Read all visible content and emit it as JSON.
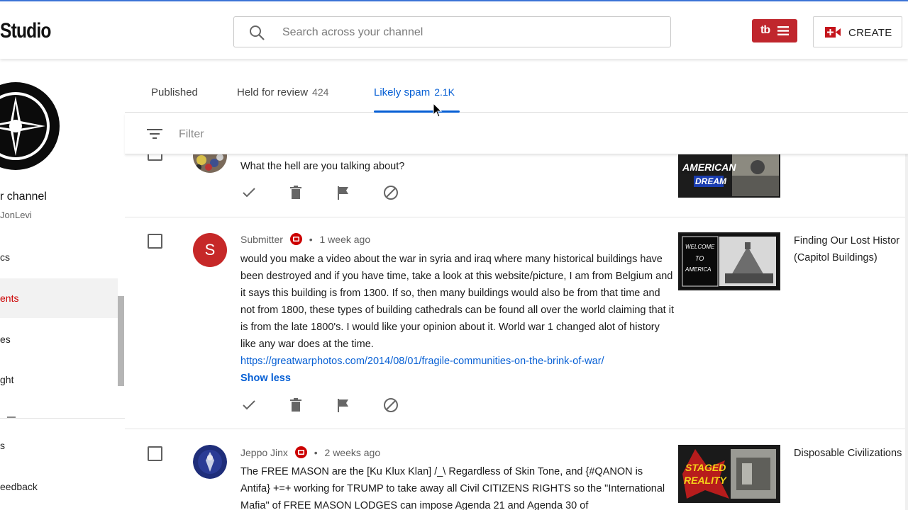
{
  "app": {
    "logo_text": "Studio"
  },
  "header": {
    "search_placeholder": "Search across your channel",
    "tubebuddy_label": "tb",
    "create_label": "CREATE"
  },
  "sidebar": {
    "channel_title": "r channel",
    "channel_handle": "JonLevi",
    "items": [
      {
        "label": "cs"
      },
      {
        "label": "ents",
        "active": true
      },
      {
        "label": "es"
      },
      {
        "label": "ght"
      },
      {
        "label": "s"
      },
      {
        "label": "eedback"
      }
    ]
  },
  "tabs": [
    {
      "label": "Published",
      "count": ""
    },
    {
      "label": "Held for review",
      "count": "424"
    },
    {
      "label": "Likely spam",
      "count": "2.1K",
      "active": true
    }
  ],
  "filter": {
    "placeholder": "Filter"
  },
  "comments": [
    {
      "text": "What the hell are you talking about?",
      "thumbnail_text": [
        "AMERICAN",
        "DREAM"
      ]
    },
    {
      "author": "Submitter",
      "time": "1 week ago",
      "avatar_letter": "S",
      "avatar_color": "#c62828",
      "text": "would you make a video about the war in syria and iraq where many historical buildings have been destroyed and if you have time, take a look at this website/picture, I am from Belgium and it says this building is from 1300. If so, then many buildings would also be from that time and not from 1800, these types of building cathedrals can be found all over the world claiming that it is from the late 1800's. I would  like your opinion about it. World war 1 changed alot of history like any war does at the time.",
      "link": "https://greatwarphotos.com/2014/08/01/fragile-communities-on-the-brink-of-war/",
      "show_less": "Show less",
      "video_title_line1": "Finding Our Lost Histor",
      "video_title_line2": "(Capitol Buildings)",
      "thumbnail_text": [
        "WELCOME",
        "TO",
        "AMERICA"
      ]
    },
    {
      "author": "Jeppo Jinx",
      "time": "2 weeks ago",
      "text": "The FREE MASON are the [Ku Klux Klan] /_\\ Regardless of Skin Tone, and {#QANON is Antifa} +=+ working for TRUMP to take away all Civil CITIZENS RIGHTS so the \"International Mafia\" of FREE MASON LODGES can impose Agenda 21 and Agenda 30 of",
      "video_title_line1": "Disposable Civilizations",
      "thumbnail_text": [
        "STAGED",
        "REALITY"
      ]
    }
  ],
  "colors": {
    "accent": "#065fd4",
    "brand_red": "#c0262d",
    "active_nav": "#cc0000"
  }
}
